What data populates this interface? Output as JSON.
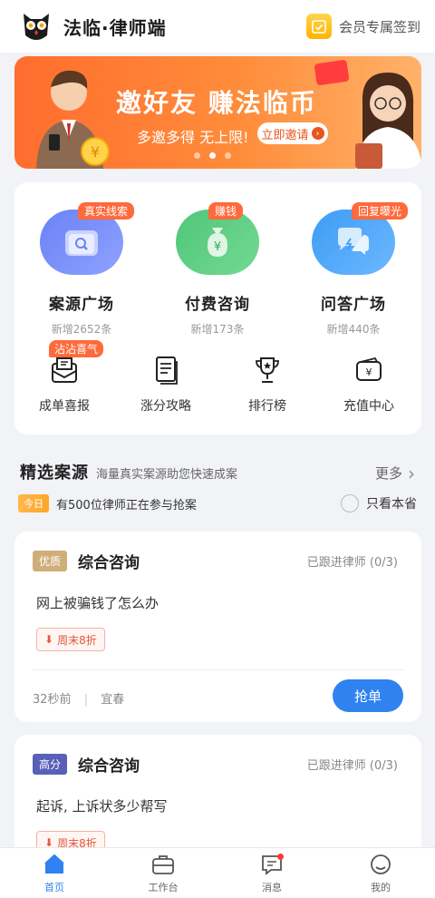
{
  "header": {
    "brand": "法临·律师端",
    "checkin_label": "会员专属签到"
  },
  "banner": {
    "title": "邀好友 赚法临币",
    "subtitle": "多邀多得 无上限!",
    "button_label": "立即邀请"
  },
  "services": [
    {
      "badge": "真实线索",
      "name": "案源广场",
      "count": "新增2652条",
      "icon": "search-folder-icon"
    },
    {
      "badge": "赚钱",
      "name": "付费咨询",
      "count": "新增173条",
      "icon": "money-bag-icon"
    },
    {
      "badge": "回复曝光",
      "name": "问答广场",
      "count": "新增440条",
      "icon": "chat-bubbles-icon"
    }
  ],
  "tools": [
    {
      "label": "成单喜报",
      "badge": "沾沾喜气",
      "icon": "envelope-icon"
    },
    {
      "label": "涨分攻略",
      "badge": "",
      "icon": "document-icon"
    },
    {
      "label": "排行榜",
      "badge": "",
      "icon": "trophy-icon"
    },
    {
      "label": "充值中心",
      "badge": "",
      "icon": "wallet-icon"
    }
  ],
  "section": {
    "title": "精选案源",
    "subtitle": "海量真实案源助您快速成案",
    "more": "更多"
  },
  "today": {
    "tag": "今日",
    "text": "有500位律师正在参与抢案",
    "only_province": "只看本省"
  },
  "cases": [
    {
      "grade": "优质",
      "type": "综合咨询",
      "follow": "已跟进律师 (0/3)",
      "question": "网上被骗钱了怎么办",
      "discount": "周末8折",
      "time": "32秒前",
      "city": "宜春",
      "grab_label": "抢单"
    },
    {
      "grade": "高分",
      "type": "综合咨询",
      "follow": "已跟进律师 (0/3)",
      "question": "起诉, 上诉状多少帮写",
      "discount": "周末8折"
    }
  ],
  "tabbar": [
    {
      "label": "首页",
      "icon": "home-icon",
      "active": true
    },
    {
      "label": "工作台",
      "icon": "briefcase-icon",
      "active": false
    },
    {
      "label": "消息",
      "icon": "message-icon",
      "active": false
    },
    {
      "label": "我的",
      "icon": "profile-icon",
      "active": false
    }
  ],
  "colors": {
    "primary": "#2f82f0",
    "badge": "#ff6a3c",
    "banner": "#ff7a34"
  }
}
